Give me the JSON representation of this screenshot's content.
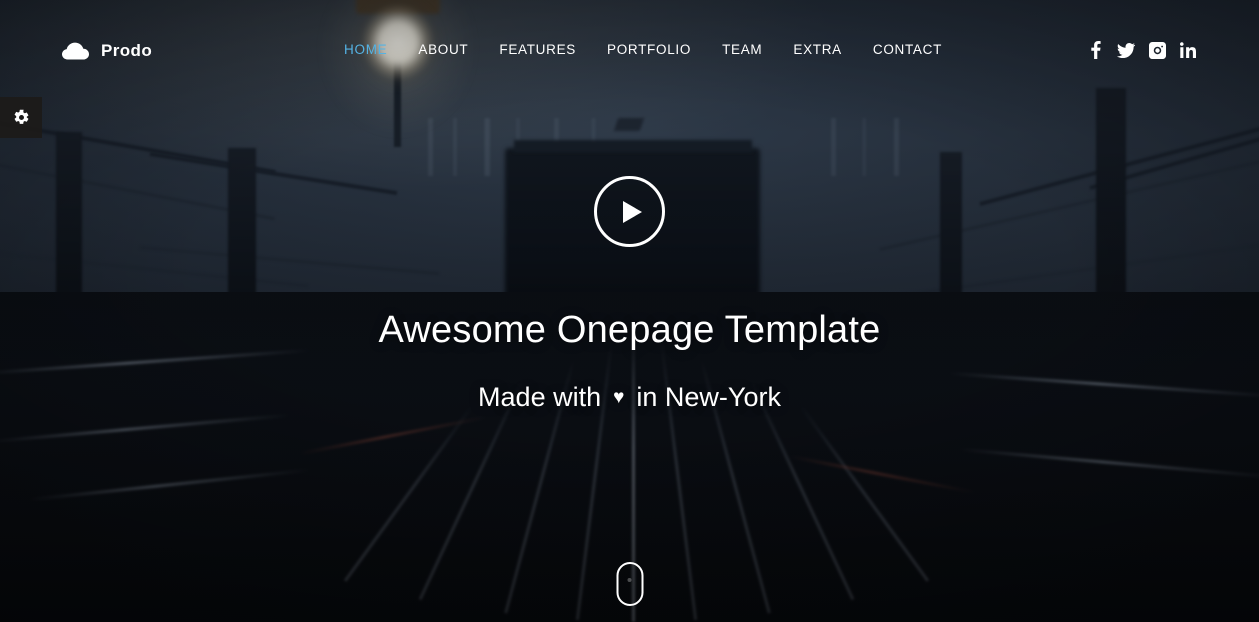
{
  "brand": {
    "name": "Prodo",
    "icon": "cloud-icon"
  },
  "nav": {
    "items": [
      {
        "label": "HOME",
        "active": true
      },
      {
        "label": "ABOUT",
        "active": false
      },
      {
        "label": "FEATURES",
        "active": false
      },
      {
        "label": "PORTFOLIO",
        "active": false
      },
      {
        "label": "TEAM",
        "active": false
      },
      {
        "label": "EXTRA",
        "active": false
      },
      {
        "label": "CONTACT",
        "active": false
      }
    ],
    "active_color": "#54b3e4",
    "color": "#ffffff"
  },
  "social": {
    "items": [
      {
        "name": "facebook-icon",
        "label": "Facebook"
      },
      {
        "name": "twitter-icon",
        "label": "Twitter"
      },
      {
        "name": "instagram-icon",
        "label": "Instagram"
      },
      {
        "name": "linkedin-icon",
        "label": "LinkedIn"
      }
    ]
  },
  "settings": {
    "icon": "gear-icon",
    "label": "Settings"
  },
  "hero": {
    "play_icon": "play-icon",
    "play_label": "Play video",
    "title": "Awesome Onepage Template",
    "subtitle_before": "Made with",
    "subtitle_heart": "♥",
    "subtitle_after": "in New-York",
    "scroll_icon": "scroll-mouse-icon",
    "scroll_label": "Scroll down"
  },
  "colors": {
    "accent": "#54b3e4",
    "text": "#ffffff",
    "sky_top": "#2b3442",
    "sky_bottom": "#0a0d12",
    "settings_tab_bg": "#1c1a18"
  }
}
